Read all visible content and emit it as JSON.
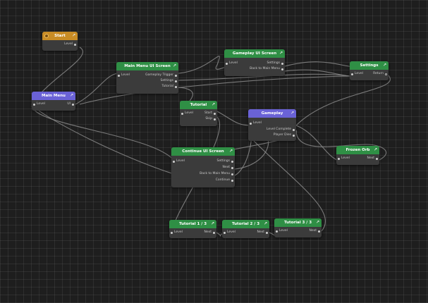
{
  "nodes": {
    "start": {
      "title": "Start",
      "color": "#c98c25",
      "outputs": [
        "Level"
      ]
    },
    "main_menu": {
      "title": "Main Menu",
      "color": "#6a62d6",
      "inputs": [
        "Level"
      ],
      "outputs": [
        "UI"
      ]
    },
    "main_menu_ui": {
      "title": "Main Menu UI Screen",
      "color": "#2f8f45",
      "inputs": [
        "Level"
      ],
      "outputs": [
        "Gameplay Trigger",
        "Settings",
        "Tutorial"
      ]
    },
    "gameplay_ui": {
      "title": "Gameplay UI Screen",
      "color": "#2f8f45",
      "inputs": [
        "Level"
      ],
      "outputs": [
        "Settings",
        "Back to Main Menu"
      ]
    },
    "settings": {
      "title": "Settings",
      "color": "#2f8f45",
      "inputs": [
        "Level"
      ],
      "outputs": [
        "Return"
      ]
    },
    "tutorial": {
      "title": "Tutorial",
      "color": "#2f8f45",
      "inputs": [
        "Level"
      ],
      "outputs": [
        "Start",
        "Skip"
      ]
    },
    "gameplay": {
      "title": "Gameplay",
      "color": "#6a62d6",
      "inputs": [
        "Level"
      ],
      "outputs": [
        "Level Complete",
        "Player Dies"
      ]
    },
    "continue_ui": {
      "title": "Continue UI Screen",
      "color": "#2f8f45",
      "inputs": [
        "Level"
      ],
      "outputs": [
        "Settings",
        "Next",
        "Back to Main Menu",
        "Continue"
      ]
    },
    "frozen_orb": {
      "title": "Frozen Orb",
      "color": "#2f8f45",
      "inputs": [
        "Level"
      ],
      "outputs": [
        "Next"
      ]
    },
    "tut1": {
      "title": "Tutorial 1 / 3",
      "color": "#2f8f45",
      "inputs": [
        "Level"
      ],
      "outputs": [
        "Next"
      ]
    },
    "tut2": {
      "title": "Tutorial 2 / 3",
      "color": "#2f8f45",
      "inputs": [
        "Level"
      ],
      "outputs": [
        "Next"
      ]
    },
    "tut3": {
      "title": "Tutorial 3 / 3",
      "color": "#2f8f45",
      "inputs": [
        "Level"
      ],
      "outputs": [
        "Next"
      ]
    }
  },
  "icons": {
    "header_action": "link-icon",
    "start_marker": "start-icon"
  },
  "theme": {
    "background": "#1e1e1e",
    "node_body": "#3b3b3b",
    "wire": "#8a8a8a"
  }
}
